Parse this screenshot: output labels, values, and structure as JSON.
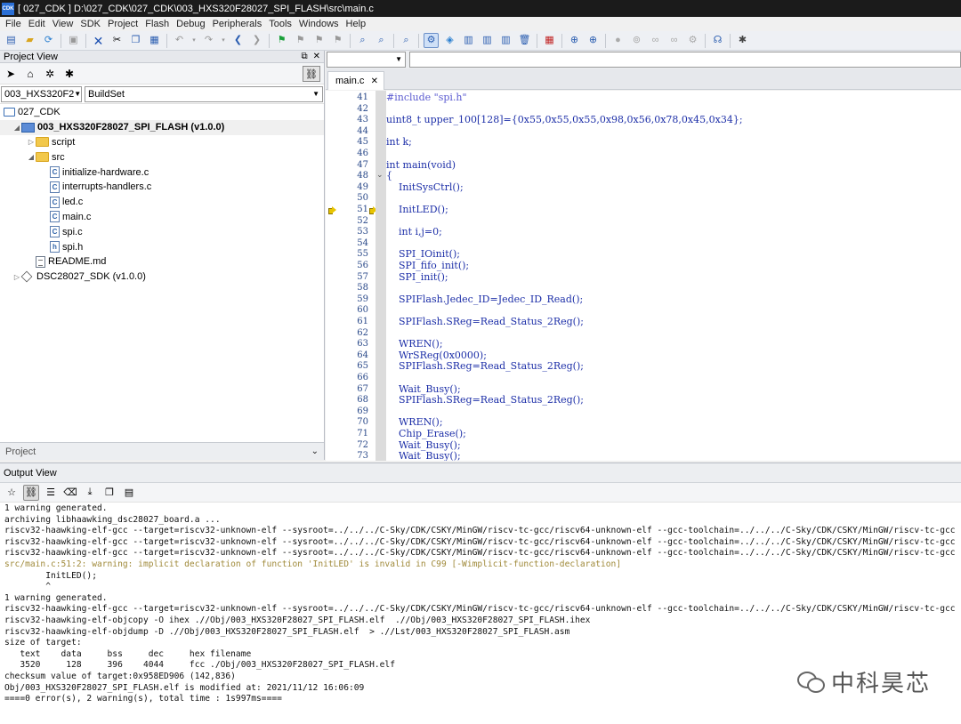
{
  "window": {
    "app_badge": "CDK",
    "title": "[ 027_CDK ] D:\\027_CDK\\027_CDK\\003_HXS320F28027_SPI_FLASH\\src\\main.c"
  },
  "menu": [
    "File",
    "Edit",
    "View",
    "SDK",
    "Project",
    "Flash",
    "Debug",
    "Peripherals",
    "Tools",
    "Windows",
    "Help"
  ],
  "project_view": {
    "title": "Project View",
    "project_select": "003_HXS320F2",
    "buildset_select": "BuildSet",
    "bottom_tab": "Project",
    "tree": [
      {
        "label": "027_CDK",
        "icon": "monitor-icon",
        "level": 0,
        "expander": ""
      },
      {
        "label": "003_HXS320F28027_SPI_FLASH (v1.0.0)",
        "icon": "project-icon",
        "level": 1,
        "expander": "◢",
        "bold": true
      },
      {
        "label": "script",
        "icon": "folder-icon",
        "level": 2,
        "expander": "▷"
      },
      {
        "label": "src",
        "icon": "folder-icon",
        "level": 2,
        "expander": "◢"
      },
      {
        "label": "initialize-hardware.c",
        "icon": "c-file-icon",
        "level": 3,
        "expander": ""
      },
      {
        "label": "interrupts-handlers.c",
        "icon": "c-file-icon",
        "level": 3,
        "expander": ""
      },
      {
        "label": "led.c",
        "icon": "c-file-icon",
        "level": 3,
        "expander": ""
      },
      {
        "label": "main.c",
        "icon": "c-file-icon",
        "level": 3,
        "expander": ""
      },
      {
        "label": "spi.c",
        "icon": "c-file-icon",
        "level": 3,
        "expander": ""
      },
      {
        "label": "spi.h",
        "icon": "h-file-icon",
        "level": 3,
        "expander": ""
      },
      {
        "label": "README.md",
        "icon": "md-file-icon",
        "level": 2,
        "expander": ""
      },
      {
        "label": "DSC28027_SDK (v1.0.0)",
        "icon": "sdk-icon",
        "level": 1,
        "expander": "▷"
      }
    ]
  },
  "editor": {
    "tab_label": "main.c",
    "lines": [
      {
        "n": "41",
        "code": "#include \"spi.h\"",
        "kind": "pp"
      },
      {
        "n": "42",
        "code": "",
        "kind": "tx"
      },
      {
        "n": "43",
        "code": "uint8_t upper_100[128]={0x55,0x55,0x55,0x98,0x56,0x78,0x45,0x34};",
        "kind": "tx"
      },
      {
        "n": "44",
        "code": "",
        "kind": "tx"
      },
      {
        "n": "45",
        "code": "int k;",
        "kind": "tx"
      },
      {
        "n": "46",
        "code": "",
        "kind": "tx"
      },
      {
        "n": "47",
        "code": "int main(void)",
        "kind": "tx"
      },
      {
        "n": "48",
        "code": "{",
        "kind": "tx",
        "fold": "⌄"
      },
      {
        "n": "49",
        "code": "    InitSysCtrl();",
        "kind": "tx"
      },
      {
        "n": "50",
        "code": "",
        "kind": "tx"
      },
      {
        "n": "51",
        "code": "    InitLED();",
        "kind": "tx",
        "arrow": true
      },
      {
        "n": "52",
        "code": "",
        "kind": "tx"
      },
      {
        "n": "53",
        "code": "    int i,j=0;",
        "kind": "tx"
      },
      {
        "n": "54",
        "code": "",
        "kind": "tx"
      },
      {
        "n": "55",
        "code": "    SPI_IOinit();",
        "kind": "tx"
      },
      {
        "n": "56",
        "code": "    SPI_fifo_init();",
        "kind": "tx"
      },
      {
        "n": "57",
        "code": "    SPI_init();",
        "kind": "tx"
      },
      {
        "n": "58",
        "code": "",
        "kind": "tx"
      },
      {
        "n": "59",
        "code": "    SPIFlash.Jedec_ID=Jedec_ID_Read();",
        "kind": "tx"
      },
      {
        "n": "60",
        "code": "",
        "kind": "tx"
      },
      {
        "n": "61",
        "code": "    SPIFlash.SReg=Read_Status_2Reg();",
        "kind": "tx"
      },
      {
        "n": "62",
        "code": "",
        "kind": "tx"
      },
      {
        "n": "63",
        "code": "    WREN();",
        "kind": "tx"
      },
      {
        "n": "64",
        "code": "    WrSReg(0x0000);",
        "kind": "tx"
      },
      {
        "n": "65",
        "code": "    SPIFlash.SReg=Read_Status_2Reg();",
        "kind": "tx"
      },
      {
        "n": "66",
        "code": "",
        "kind": "tx"
      },
      {
        "n": "67",
        "code": "    Wait_Busy();",
        "kind": "tx"
      },
      {
        "n": "68",
        "code": "    SPIFlash.SReg=Read_Status_2Reg();",
        "kind": "tx"
      },
      {
        "n": "69",
        "code": "",
        "kind": "tx"
      },
      {
        "n": "70",
        "code": "    WREN();",
        "kind": "tx"
      },
      {
        "n": "71",
        "code": "    Chip_Erase();",
        "kind": "tx"
      },
      {
        "n": "72",
        "code": "    Wait_Busy();",
        "kind": "tx"
      },
      {
        "n": "73",
        "code": "    Wait_Busy();",
        "kind": "tx"
      }
    ]
  },
  "output_view": {
    "title": "Output View",
    "lines": [
      {
        "text": "1 warning generated.",
        "kind": "normal"
      },
      {
        "text": "archiving libhaawking_dsc28027_board.a ...",
        "kind": "normal"
      },
      {
        "text": "riscv32-haawking-elf-gcc --target=riscv32-unknown-elf --sysroot=../../../C-Sky/CDK/CSKY/MinGW/riscv-tc-gcc/riscv64-unknown-elf --gcc-toolchain=../../../C-Sky/CDK/CSKY/MinGW/riscv-tc-gcc",
        "kind": "normal"
      },
      {
        "text": "riscv32-haawking-elf-gcc --target=riscv32-unknown-elf --sysroot=../../../C-Sky/CDK/CSKY/MinGW/riscv-tc-gcc/riscv64-unknown-elf --gcc-toolchain=../../../C-Sky/CDK/CSKY/MinGW/riscv-tc-gcc",
        "kind": "normal"
      },
      {
        "text": "riscv32-haawking-elf-gcc --target=riscv32-unknown-elf --sysroot=../../../C-Sky/CDK/CSKY/MinGW/riscv-tc-gcc/riscv64-unknown-elf --gcc-toolchain=../../../C-Sky/CDK/CSKY/MinGW/riscv-tc-gcc",
        "kind": "normal"
      },
      {
        "text": "src/main.c:51:2: warning: implicit declaration of function 'InitLED' is invalid in C99 [-Wimplicit-function-declaration]",
        "kind": "warn"
      },
      {
        "text": "        InitLED();",
        "kind": "normal"
      },
      {
        "text": "        ^",
        "kind": "normal"
      },
      {
        "text": "1 warning generated.",
        "kind": "normal"
      },
      {
        "text": "riscv32-haawking-elf-gcc --target=riscv32-unknown-elf --sysroot=../../../C-Sky/CDK/CSKY/MinGW/riscv-tc-gcc/riscv64-unknown-elf --gcc-toolchain=../../../C-Sky/CDK/CSKY/MinGW/riscv-tc-gcc",
        "kind": "normal"
      },
      {
        "text": "riscv32-haawking-elf-objcopy -O ihex .//Obj/003_HXS320F28027_SPI_FLASH.elf  .//Obj/003_HXS320F28027_SPI_FLASH.ihex",
        "kind": "normal"
      },
      {
        "text": "riscv32-haawking-elf-objdump -D .//Obj/003_HXS320F28027_SPI_FLASH.elf  > .//Lst/003_HXS320F28027_SPI_FLASH.asm",
        "kind": "normal"
      },
      {
        "text": "size of target:",
        "kind": "normal"
      },
      {
        "text": "   text    data     bss     dec     hex filename",
        "kind": "normal"
      },
      {
        "text": "   3520     128     396    4044     fcc ./Obj/003_HXS320F28027_SPI_FLASH.elf",
        "kind": "normal"
      },
      {
        "text": "checksum value of target:0x958ED906 (142,836)",
        "kind": "normal"
      },
      {
        "text": "Obj/003_HXS320F28027_SPI_FLASH.elf is modified at: 2021/11/12 16:06:09",
        "kind": "normal"
      },
      {
        "text": "====0 error(s), 2 warning(s), total time : 1s997ms====",
        "kind": "normal"
      }
    ]
  },
  "watermark": {
    "text": "中科昊芯",
    "icon": "wechat-icon"
  }
}
